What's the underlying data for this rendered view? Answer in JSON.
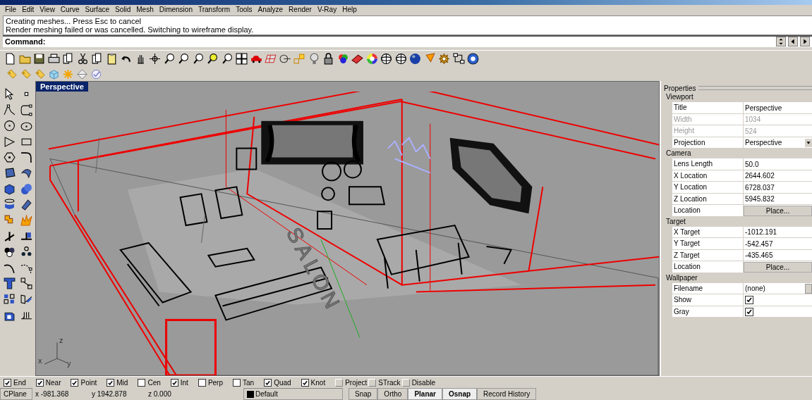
{
  "menu": [
    "File",
    "Edit",
    "View",
    "Curve",
    "Surface",
    "Solid",
    "Mesh",
    "Dimension",
    "Transform",
    "Tools",
    "Analyze",
    "Render",
    "V-Ray",
    "Help"
  ],
  "command": {
    "history": [
      "Creating meshes... Press Esc to cancel",
      "Render meshing failed or was cancelled. Switching to wireframe display."
    ],
    "prompt": "Command:"
  },
  "viewport": {
    "tab": {
      "label": "Perspective",
      "selected": true
    },
    "floor_label": "SALON",
    "axes": [
      "z",
      "x",
      "y"
    ]
  },
  "properties": {
    "title": "Properties",
    "sections": [
      {
        "title": "Viewport",
        "rows": [
          {
            "label": "Title",
            "value": "Perspective",
            "kind": "text",
            "disabled": false
          },
          {
            "label": "Width",
            "value": "1034",
            "kind": "text",
            "disabled": true
          },
          {
            "label": "Height",
            "value": "524",
            "kind": "text",
            "disabled": true
          },
          {
            "label": "Projection",
            "value": "Perspective",
            "kind": "dropdown",
            "disabled": false
          }
        ]
      },
      {
        "title": "Camera",
        "rows": [
          {
            "label": "Lens Length",
            "value": "50.0",
            "kind": "text",
            "disabled": false
          },
          {
            "label": "X Location",
            "value": "2644.602",
            "kind": "text",
            "disabled": false
          },
          {
            "label": "Y Location",
            "value": "6728.037",
            "kind": "text",
            "disabled": false
          },
          {
            "label": "Z Location",
            "value": "5945.832",
            "kind": "text",
            "disabled": false
          },
          {
            "label": "Location",
            "value": "Place...",
            "kind": "button",
            "disabled": false
          }
        ]
      },
      {
        "title": "Target",
        "rows": [
          {
            "label": "X Target",
            "value": "-1012.191",
            "kind": "text",
            "disabled": false
          },
          {
            "label": "Y Target",
            "value": "-542.457",
            "kind": "text",
            "disabled": false
          },
          {
            "label": "Z Target",
            "value": "-435.465",
            "kind": "text",
            "disabled": false
          },
          {
            "label": "Location",
            "value": "Place...",
            "kind": "button",
            "disabled": false
          }
        ]
      },
      {
        "title": "Wallpaper",
        "rows": [
          {
            "label": "Filename",
            "value": "(none)",
            "kind": "file",
            "disabled": false
          },
          {
            "label": "Show",
            "kind": "checkbox",
            "checked": true,
            "disabled": false
          },
          {
            "label": "Gray",
            "kind": "checkbox",
            "checked": true,
            "disabled": false
          }
        ]
      }
    ]
  },
  "osnaps": [
    {
      "label": "End",
      "checked": true,
      "kind": "check"
    },
    {
      "label": "Near",
      "checked": true,
      "kind": "check"
    },
    {
      "label": "Point",
      "checked": true,
      "kind": "check"
    },
    {
      "label": "Mid",
      "checked": true,
      "kind": "check"
    },
    {
      "label": "Cen",
      "checked": false,
      "kind": "check"
    },
    {
      "label": "Int",
      "checked": true,
      "kind": "check"
    },
    {
      "label": "Perp",
      "checked": false,
      "kind": "check"
    },
    {
      "label": "Tan",
      "checked": false,
      "kind": "check"
    },
    {
      "label": "Quad",
      "checked": true,
      "kind": "check"
    },
    {
      "label": "Knot",
      "checked": true,
      "kind": "check"
    },
    {
      "label": "Project",
      "checked": false,
      "kind": "toggle"
    },
    {
      "label": "STrack",
      "checked": false,
      "kind": "toggle"
    },
    {
      "label": "Disable",
      "checked": false,
      "kind": "toggle"
    }
  ],
  "status": {
    "cplane": "CPlane",
    "x": "x -981.368",
    "y": "y 1942.878",
    "z": "z 0.000",
    "layer": {
      "name": "Default",
      "color": "#000000"
    },
    "toggles": [
      {
        "label": "Snap",
        "on": false
      },
      {
        "label": "Ortho",
        "on": false
      },
      {
        "label": "Planar",
        "on": true
      },
      {
        "label": "Osnap",
        "on": true
      },
      {
        "label": "Record History",
        "on": false
      }
    ]
  }
}
